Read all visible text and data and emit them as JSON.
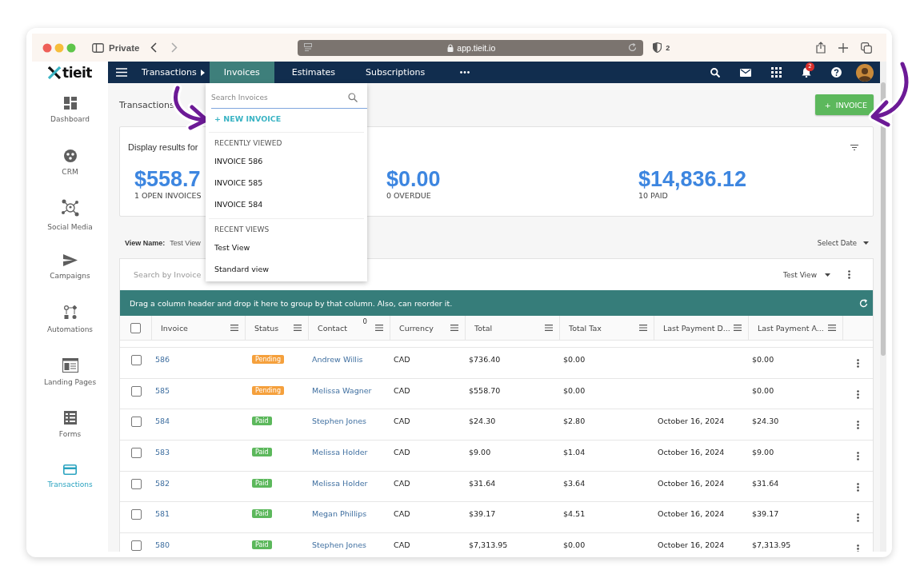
{
  "browser": {
    "private_label": "Private",
    "url": "app.tieit.io",
    "shield_count": "2"
  },
  "sidebar": {
    "logo": "tieit",
    "items": [
      {
        "label": "Dashboard",
        "selected": false
      },
      {
        "label": "CRM",
        "selected": false
      },
      {
        "label": "Social Media",
        "selected": false
      },
      {
        "label": "Campaigns",
        "selected": false
      },
      {
        "label": "Automations",
        "selected": false
      },
      {
        "label": "Landing Pages",
        "selected": false
      },
      {
        "label": "Forms",
        "selected": false
      },
      {
        "label": "Transactions",
        "selected": true
      }
    ]
  },
  "navbar": {
    "breadcrumb": "Transactions",
    "tabs": [
      {
        "label": "Invoices",
        "selected": true
      },
      {
        "label": "Estimates",
        "selected": false
      },
      {
        "label": "Subscriptions",
        "selected": false
      }
    ],
    "notification_count": "2"
  },
  "page": {
    "title": "Transactions",
    "new_button": "+  INVOICE"
  },
  "summary": {
    "label": "Display results for",
    "metrics": [
      {
        "value": "$558.7",
        "caption": "1 OPEN INVOICES"
      },
      {
        "value": "$0.00",
        "caption": "0 OVERDUE"
      },
      {
        "value": "$14,836.12",
        "caption": "10 PAID"
      }
    ]
  },
  "view": {
    "label": "View Name:",
    "value": "Test View",
    "date_select": "Select Date"
  },
  "grid": {
    "search_placeholder": "Search by Invoice",
    "view_select": "Test View",
    "group_hint": "Drag a column header and drop it here to group by that column. Also, can reorder it.",
    "all_checked": false,
    "columns": [
      {
        "label": "Invoice"
      },
      {
        "label": "Status"
      },
      {
        "label": "Contact",
        "badge": "0"
      },
      {
        "label": "Currency"
      },
      {
        "label": "Total"
      },
      {
        "label": "Total Tax"
      },
      {
        "label": "Last Payment D..."
      },
      {
        "label": "Last Payment A..."
      }
    ],
    "rows": [
      {
        "checked": false,
        "invoice": "586",
        "status": "Pending",
        "kind": "pending",
        "contact": "Andrew Willis",
        "currency": "CAD",
        "total": "$736.40",
        "total_tax": "$0.00",
        "last_payment_amount": "$0.00"
      },
      {
        "checked": false,
        "invoice": "585",
        "status": "Pending",
        "kind": "pending",
        "contact": "Melissa Wagner",
        "currency": "CAD",
        "total": "$558.70",
        "total_tax": "$0.00",
        "last_payment_amount": "$0.00"
      },
      {
        "checked": false,
        "invoice": "584",
        "status": "Paid",
        "kind": "paid",
        "contact": "Stephen Jones",
        "currency": "CAD",
        "total": "$24.30",
        "total_tax": "$2.80",
        "last_payment_date": "October 16, 2024",
        "last_payment_amount": "$24.30"
      },
      {
        "checked": false,
        "invoice": "583",
        "status": "Paid",
        "kind": "paid",
        "contact": "Melissa Holder",
        "currency": "CAD",
        "total": "$9.00",
        "total_tax": "$1.04",
        "last_payment_date": "October 16, 2024",
        "last_payment_amount": "$9.00"
      },
      {
        "checked": false,
        "invoice": "582",
        "status": "Paid",
        "kind": "paid",
        "contact": "Melissa Holder",
        "currency": "CAD",
        "total": "$31.64",
        "total_tax": "$3.64",
        "last_payment_date": "October 16, 2024",
        "last_payment_amount": "$31.64"
      },
      {
        "checked": false,
        "invoice": "581",
        "status": "Paid",
        "kind": "paid",
        "contact": "Megan Phillips",
        "currency": "CAD",
        "total": "$39.17",
        "total_tax": "$4.51",
        "last_payment_date": "October 16, 2024",
        "last_payment_amount": "$39.17"
      },
      {
        "checked": false,
        "invoice": "580",
        "status": "Paid",
        "kind": "paid",
        "contact": "Stephen Jones",
        "currency": "CAD",
        "total": "$7,313.95",
        "total_tax": "$0.00",
        "last_payment_date": "October 16, 2024",
        "last_payment_amount": "$7,313.95"
      }
    ]
  },
  "dropdown": {
    "search_placeholder": "Search Invoices",
    "new_label": "+ NEW INVOICE",
    "sections": [
      {
        "heading": "RECENTLY VIEWED",
        "items": [
          "INVOICE 586",
          "INVOICE 585",
          "INVOICE 584"
        ]
      },
      {
        "heading": "RECENT VIEWS",
        "items": [
          "Test View",
          "Standard view"
        ]
      }
    ]
  }
}
